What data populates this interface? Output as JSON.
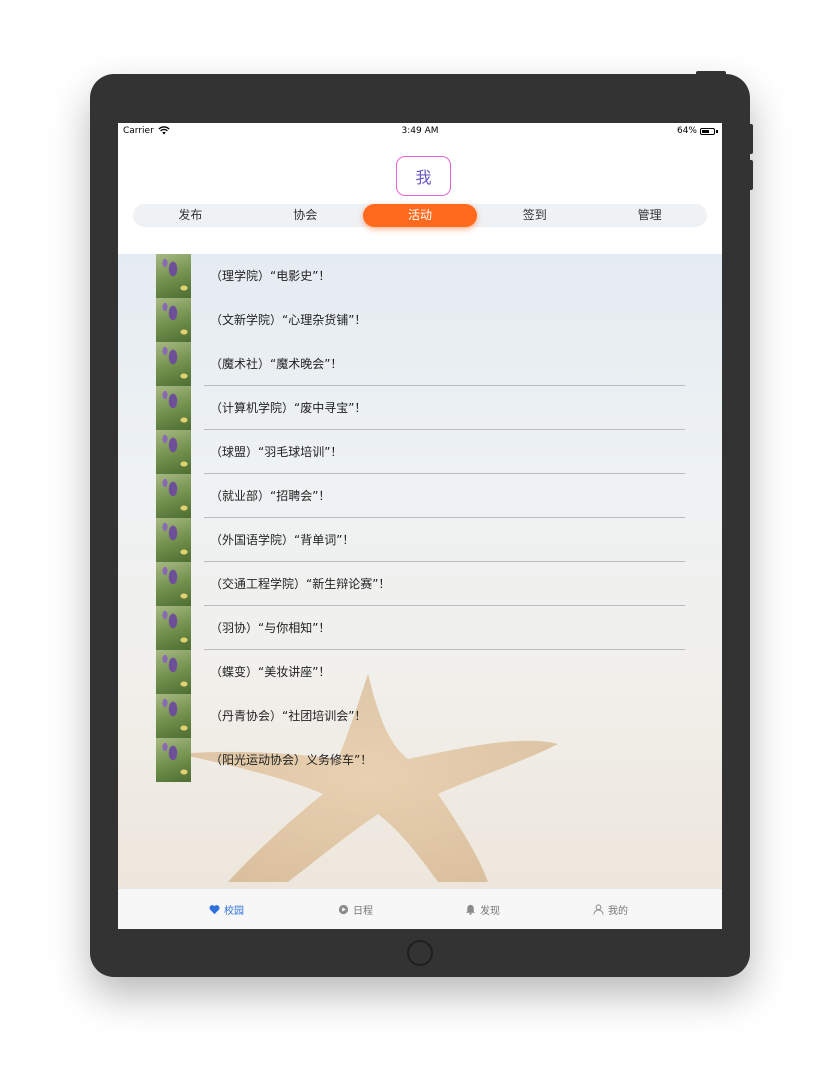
{
  "status_bar": {
    "carrier": "Carrier",
    "time": "3:49 AM",
    "battery": "64%",
    "battery_level": 0.64
  },
  "avatar": {
    "text": "我",
    "border_color": "#e066d6"
  },
  "segments": {
    "items": [
      "发布",
      "协会",
      "活动",
      "签到",
      "管理"
    ],
    "active_index": 2,
    "active_color": "#ff6a1f"
  },
  "events": [
    "（理学院）“电影史”！",
    "（文新学院）“心理杂货铺”！",
    "（魔术社）“魔术晚会”！",
    "（计算机学院）“废中寻宝”！",
    "（球盟）“羽毛球培训”！",
    "（就业部）“招聘会”！",
    "（外国语学院）“背单词”！",
    "（交通工程学院）“新生辩论赛”！",
    "（羽协）“与你相知”！",
    "（蝶变）“美妆讲座”！",
    "（丹青协会）“社团培训会”！",
    "（阳光运动协会）义务修车”！"
  ],
  "tabbar": {
    "items": [
      {
        "label": "校园",
        "icon": "heart-icon",
        "active": true
      },
      {
        "label": "日程",
        "icon": "play-circle-icon",
        "active": false
      },
      {
        "label": "发现",
        "icon": "bell-icon",
        "active": false
      },
      {
        "label": "我的",
        "icon": "person-icon",
        "active": false
      }
    ],
    "active_color": "#2f6fdc"
  }
}
